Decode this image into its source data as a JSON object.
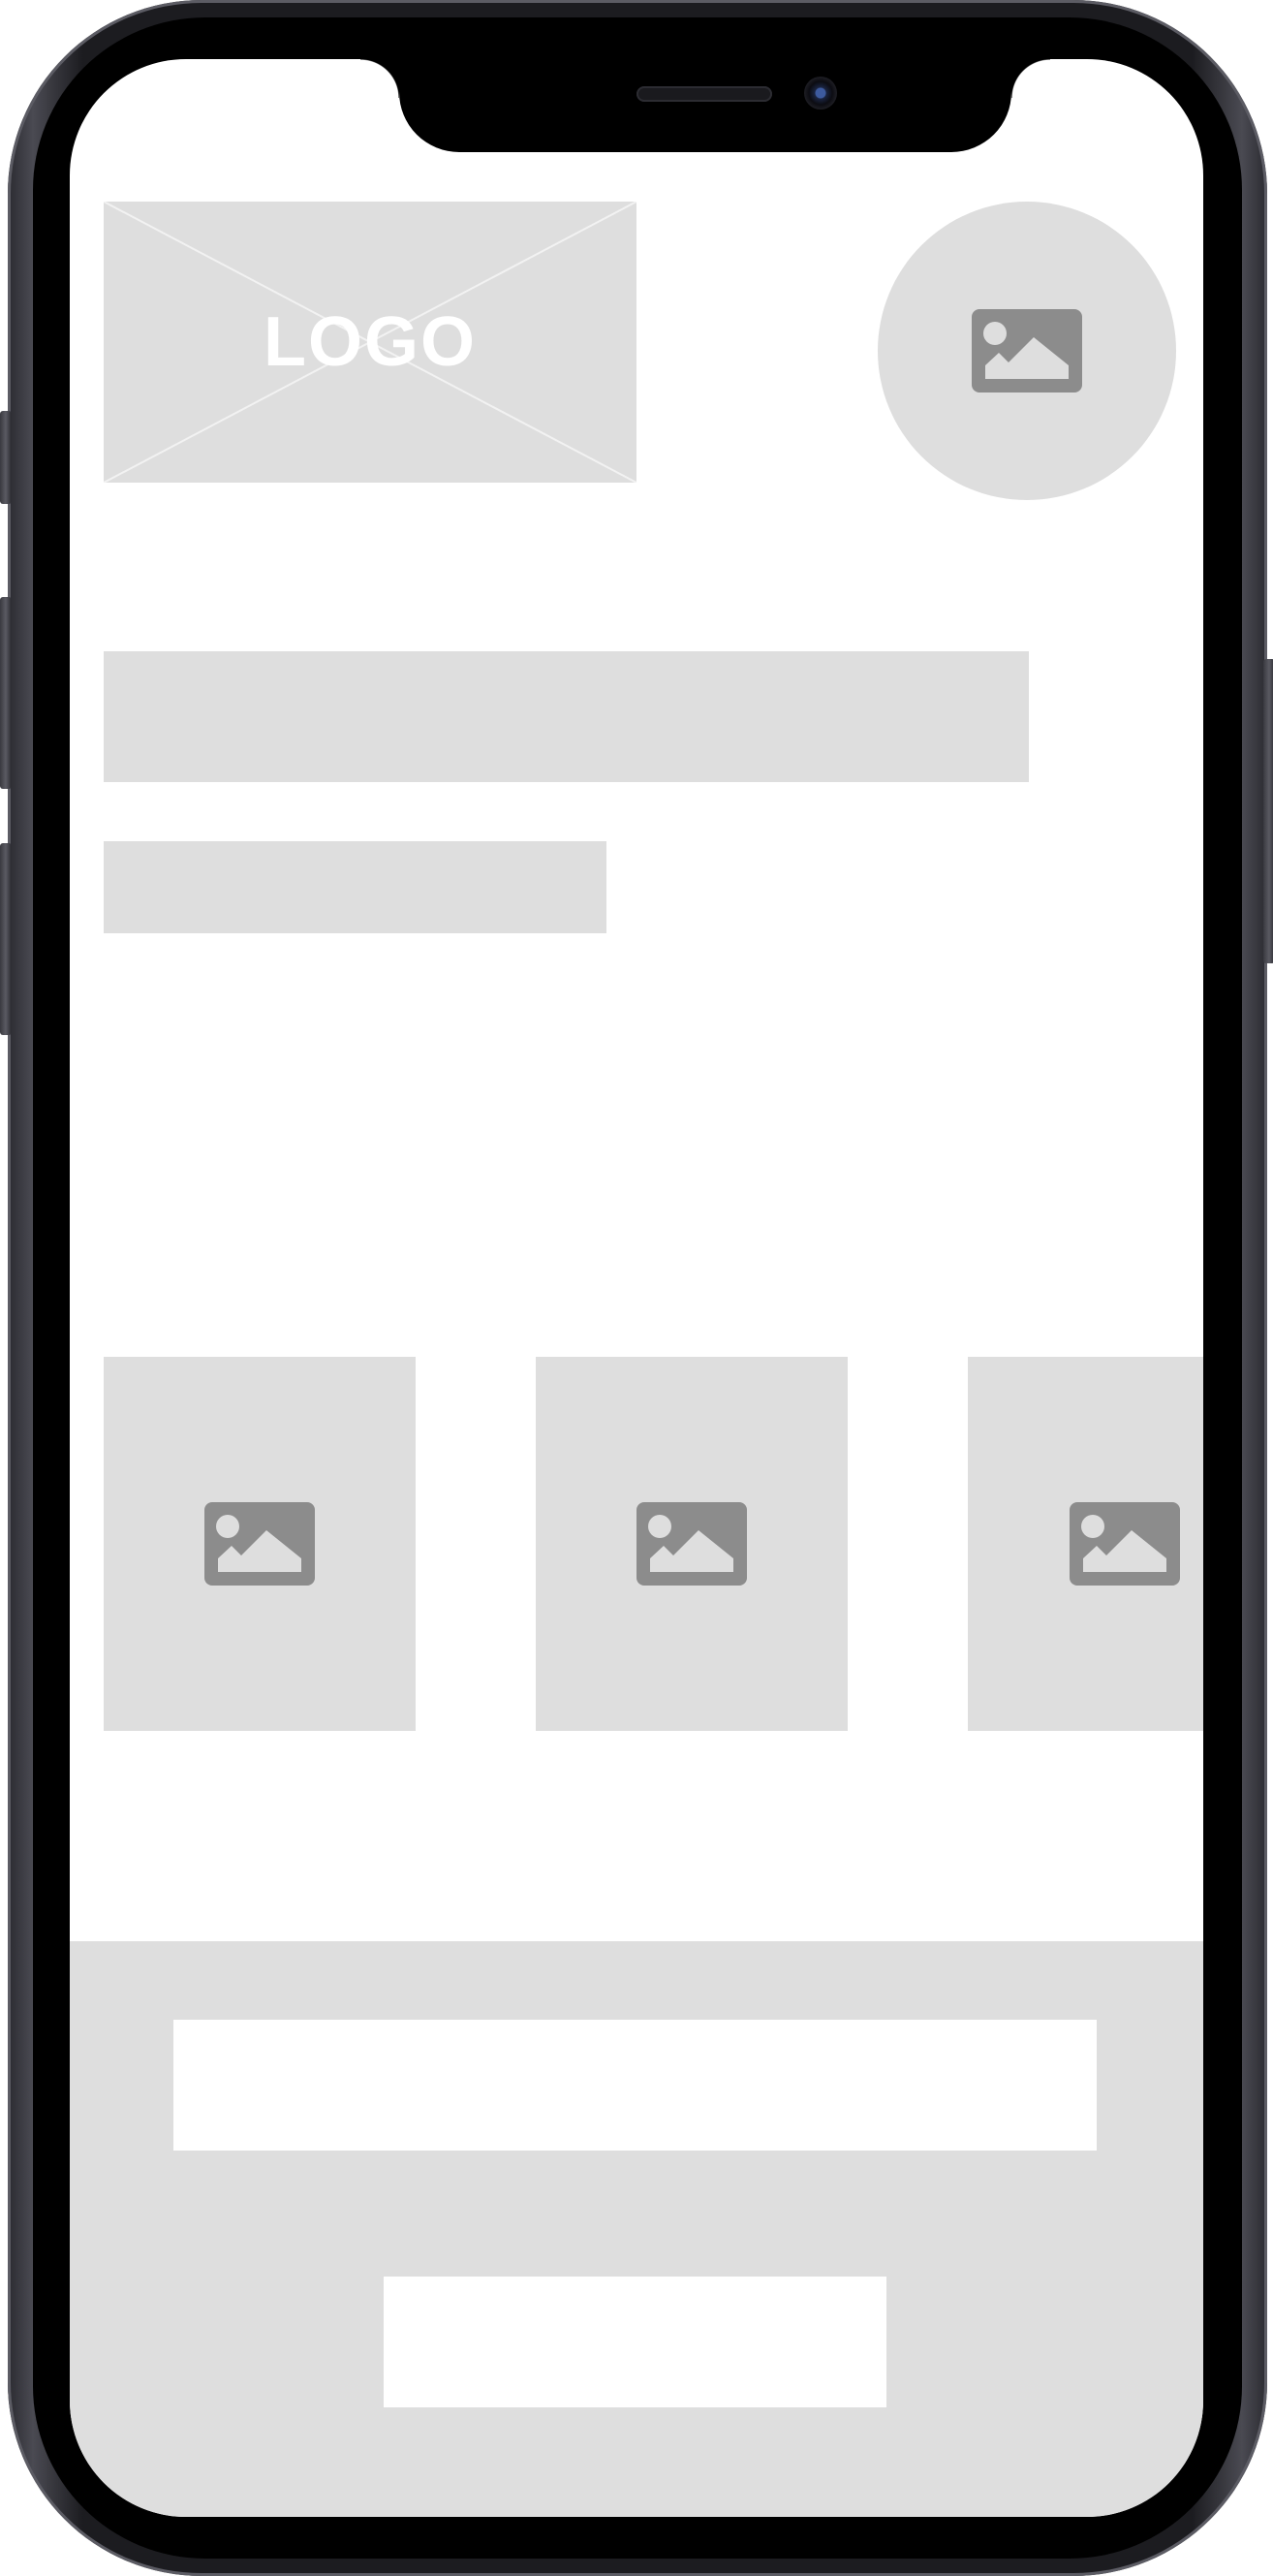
{
  "device": {
    "model": "iphone-x-frame"
  },
  "header": {
    "logo_text": "LOGO",
    "avatar_icon": "image-placeholder-icon"
  },
  "content": {
    "headline_placeholder": "",
    "subheadline_placeholder": ""
  },
  "carousel": {
    "cards": [
      {
        "icon": "image-placeholder-icon"
      },
      {
        "icon": "image-placeholder-icon"
      },
      {
        "icon": "image-placeholder-icon"
      }
    ]
  },
  "footer_panel": {
    "input_value": "",
    "input_placeholder": "",
    "button_label": ""
  },
  "colors": {
    "placeholder_gray": "#dedede",
    "icon_gray": "#8c8c8c",
    "background": "#ffffff"
  }
}
